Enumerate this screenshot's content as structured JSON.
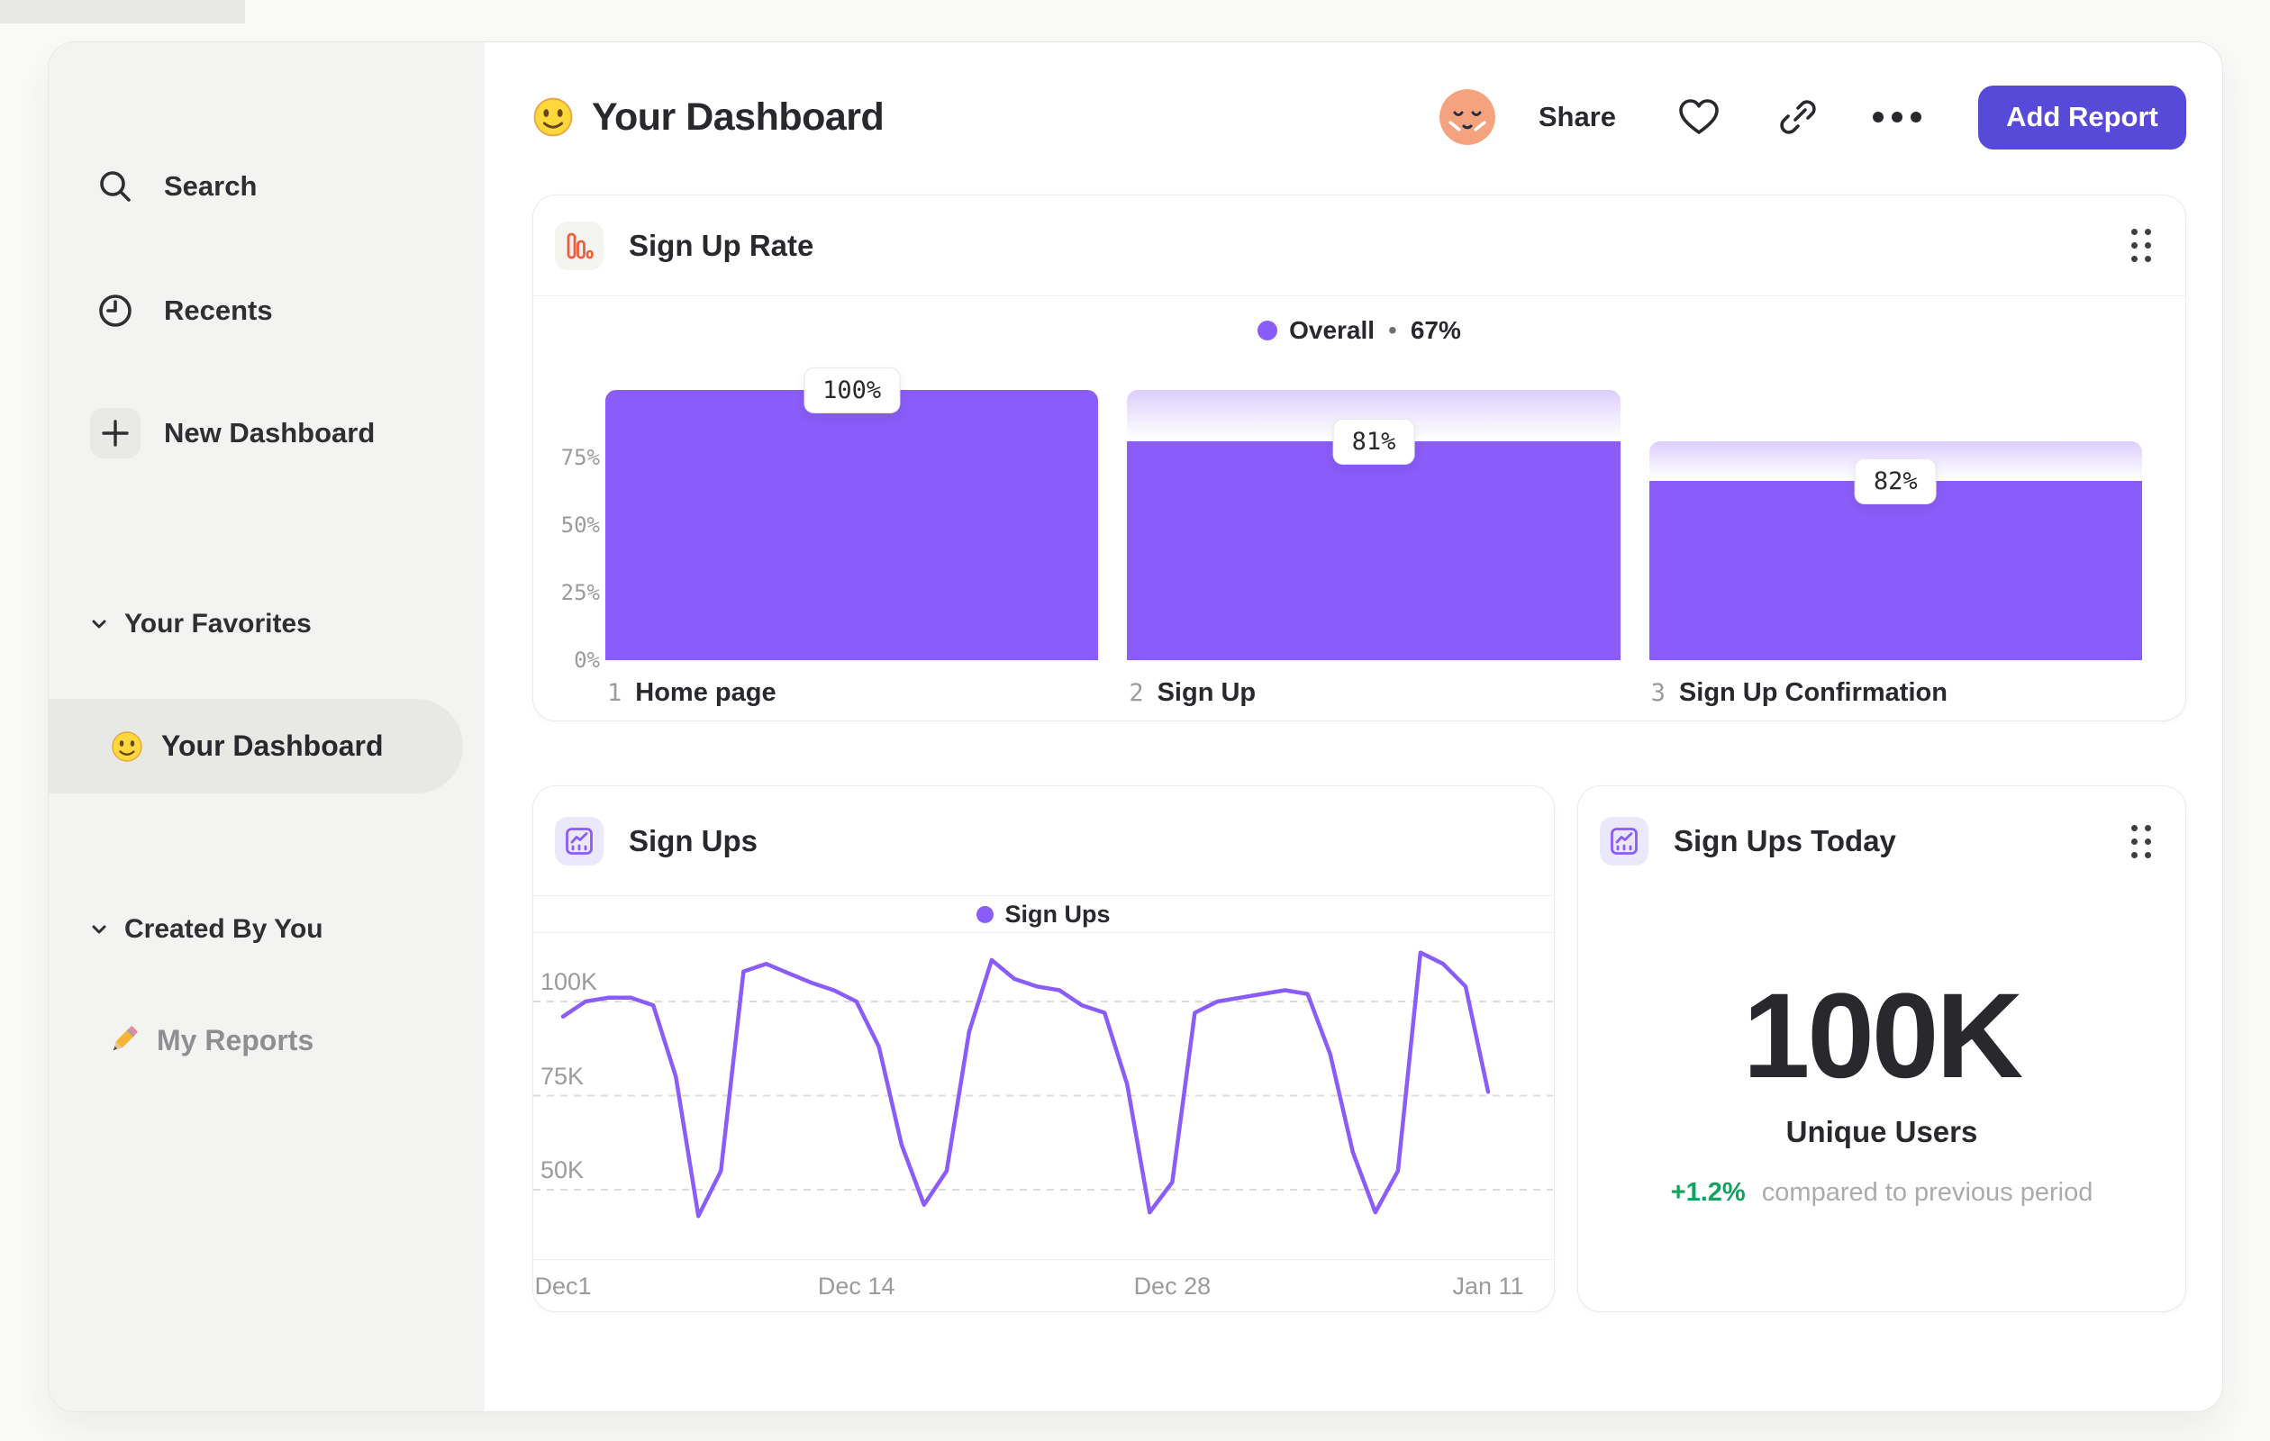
{
  "colors": {
    "accent_purple": "#8A5CF9",
    "button_indigo": "#584AD8",
    "icon_orange": "#F05C3C",
    "delta_green": "#10A35E",
    "sidebar_bg": "#F3F3F1",
    "text_dark": "#28282D",
    "text_gray": "#9B9B9B"
  },
  "sidebar": {
    "items": [
      {
        "icon": "search-icon",
        "label": "Search"
      },
      {
        "icon": "clock-icon",
        "label": "Recents"
      },
      {
        "icon": "plus-icon",
        "label": "New Dashboard"
      }
    ],
    "sections": [
      {
        "label": "Your Favorites",
        "item": {
          "icon": "smiley-emoji",
          "label": "Your Dashboard",
          "selected": true
        }
      },
      {
        "label": "Created By You",
        "item": {
          "icon": "pencil-emoji",
          "label": "My Reports",
          "selected": false
        }
      }
    ]
  },
  "header": {
    "emoji": "smiley-emoji",
    "title": "Your Dashboard",
    "share_label": "Share",
    "add_report_label": "Add Report"
  },
  "cards": {
    "funnel": {
      "title": "Sign Up Rate",
      "legend_name": "Overall",
      "legend_sep": "•",
      "legend_value": "67%"
    },
    "line": {
      "title": "Sign Ups",
      "legend_name": "Sign Ups"
    },
    "today": {
      "title": "Sign Ups Today",
      "value": "100K",
      "label": "Unique Users",
      "delta": "+1.2%",
      "delta_text": "compared to previous period"
    }
  },
  "chart_data": [
    {
      "type": "bar",
      "subtype": "funnel",
      "title": "Sign Up Rate",
      "legend": "Overall • 67%",
      "categories": [
        "Home page",
        "Sign Up",
        "Sign Up Confirmation"
      ],
      "step_numbers": [
        "1",
        "2",
        "3"
      ],
      "conversion_from_previous_pct": [
        100,
        81,
        82
      ],
      "overall_pct": [
        100,
        81,
        66.4
      ],
      "data_labels": [
        "100%",
        "81%",
        "82%"
      ],
      "yticks": [
        {
          "label": "0%",
          "value": 0
        },
        {
          "label": "25%",
          "value": 25
        },
        {
          "label": "50%",
          "value": 50
        },
        {
          "label": "75%",
          "value": 75
        }
      ],
      "ylim": [
        0,
        100
      ],
      "legend_position": "top-center",
      "grid": false
    },
    {
      "type": "line",
      "title": "Sign Ups",
      "series_name": "Sign Ups",
      "x_unit": "day",
      "x_range": "Dec 1 – Jan 11",
      "values_thousands": [
        96,
        100,
        101,
        101,
        99,
        80,
        43,
        55,
        108,
        110,
        107.5,
        105,
        103,
        100,
        88,
        62,
        46,
        55,
        92,
        111,
        106,
        104,
        103,
        99,
        97,
        78,
        44,
        52,
        97,
        100,
        101,
        102,
        103,
        102,
        86,
        60,
        44,
        55,
        113,
        110,
        104,
        76
      ],
      "gridlines": [
        {
          "label": "100K",
          "value": 100
        },
        {
          "label": "75K",
          "value": 75
        },
        {
          "label": "50K",
          "value": 50
        }
      ],
      "x_ticks": [
        {
          "label": "Dec1",
          "day": 0
        },
        {
          "label": "Dec 14",
          "day": 13
        },
        {
          "label": "Dec 28",
          "day": 27
        },
        {
          "label": "Jan 11",
          "day": 41
        }
      ],
      "ylim_thousands": [
        31,
        116
      ],
      "grid": "dashed-horizontal",
      "legend_position": "top-center"
    },
    {
      "type": "number",
      "title": "Sign Ups Today",
      "value": "100K",
      "label": "Unique Users",
      "delta": "+1.2%",
      "delta_text": "compared to previous period"
    }
  ]
}
